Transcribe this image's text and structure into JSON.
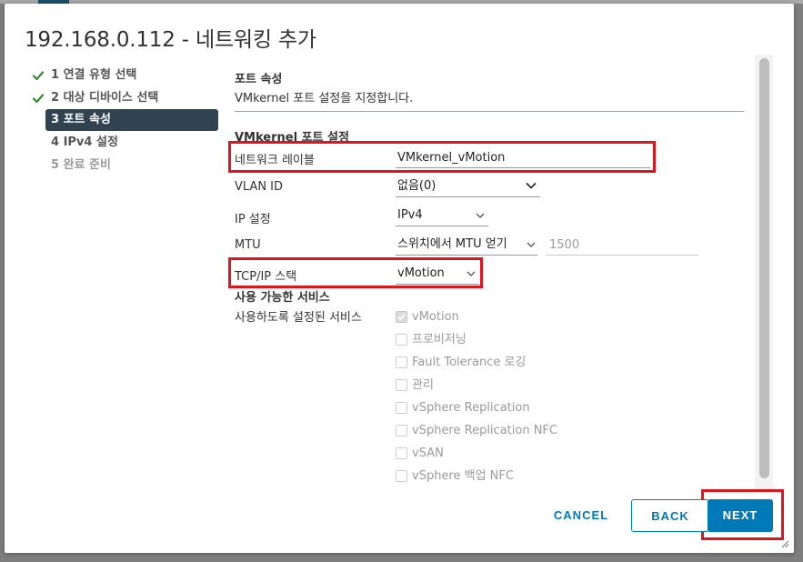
{
  "dialog": {
    "title": "192.168.0.112 - 네트워킹 추가"
  },
  "steps": [
    {
      "label": "1 연결 유형 선택",
      "state": "done"
    },
    {
      "label": "2 대상 디바이스 선택",
      "state": "done"
    },
    {
      "label": "3 포트 속성",
      "state": "active"
    },
    {
      "label": "4 IPv4 설정",
      "state": "pending"
    },
    {
      "label": "5 완료 준비",
      "state": "disabled"
    }
  ],
  "content": {
    "section_title": "포트 속성",
    "section_desc": "VMkernel 포트 설정을 지정합니다.",
    "subsection_title": "VMkernel 포트 설정",
    "fields": {
      "network_label": {
        "label": "네트워크 레이블",
        "value": "VMkernel_vMotion"
      },
      "vlan_id": {
        "label": "VLAN ID",
        "value": "없음(0)"
      },
      "ip_settings": {
        "label": "IP 설정",
        "value": "IPv4"
      },
      "mtu": {
        "label": "MTU",
        "value": "스위치에서 MTU 얻기",
        "input_value": "1500"
      },
      "tcpip_stack": {
        "label": "TCP/IP 스택",
        "value": "vMotion"
      }
    },
    "services_title": "사용 가능한 서비스",
    "services_label": "사용하도록 설정된 서비스",
    "services": [
      {
        "label": "vMotion",
        "checked": true
      },
      {
        "label": "프로비저닝",
        "checked": false
      },
      {
        "label": "Fault Tolerance 로깅",
        "checked": false
      },
      {
        "label": "관리",
        "checked": false
      },
      {
        "label": "vSphere Replication",
        "checked": false
      },
      {
        "label": "vSphere Replication NFC",
        "checked": false
      },
      {
        "label": "vSAN",
        "checked": false
      },
      {
        "label": "vSphere 백업 NFC",
        "checked": false
      }
    ]
  },
  "buttons": {
    "cancel": "CANCEL",
    "back": "BACK",
    "next": "NEXT"
  },
  "colors": {
    "accent": "#0079b8",
    "active_step_bg": "#314351",
    "check_green": "#2f8a2f",
    "highlight_red": "#e0141e"
  }
}
